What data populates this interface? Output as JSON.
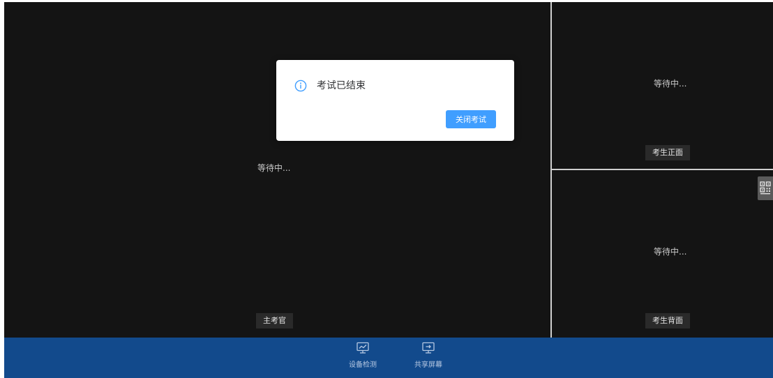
{
  "panes": {
    "main": {
      "waiting": "等待中...",
      "label": "主考官"
    },
    "front": {
      "waiting": "等待中...",
      "label": "考生正面"
    },
    "back": {
      "waiting": "等待中...",
      "label": "考生背面"
    }
  },
  "toolbar": {
    "device_check": {
      "label": "设备检测",
      "icon": "monitor-chart-icon"
    },
    "share_screen": {
      "label": "共享屏幕",
      "icon": "screen-share-icon"
    }
  },
  "side_tab": {
    "icon": "qr-code-icon"
  },
  "dialog": {
    "icon": "info-circle-icon",
    "message": "考试已结束",
    "close_button": "关闭考试"
  },
  "colors": {
    "background": "#141414",
    "toolbar": "#124a8c",
    "primary_button": "#409eff",
    "info_icon": "#409eff"
  }
}
